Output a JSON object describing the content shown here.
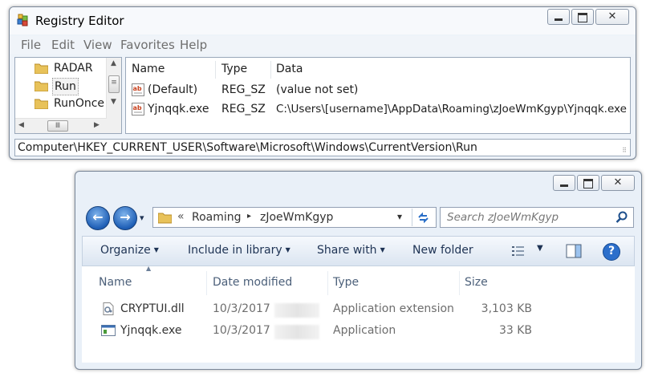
{
  "registry": {
    "title": "Registry Editor",
    "menu": [
      "File",
      "Edit",
      "View",
      "Favorites",
      "Help"
    ],
    "tree": [
      {
        "label": "RADAR",
        "selected": false
      },
      {
        "label": "Run",
        "selected": true
      },
      {
        "label": "RunOnce",
        "selected": false
      }
    ],
    "columns": [
      "Name",
      "Type",
      "Data"
    ],
    "values": [
      {
        "name": "(Default)",
        "type": "REG_SZ",
        "data": "(value not set)"
      },
      {
        "name": "Yjnqqk.exe",
        "type": "REG_SZ",
        "data": "C:\\Users\\[username]\\AppData\\Roaming\\zJoeWmKgyp\\Yjnqqk.exe"
      }
    ],
    "status": "Computer\\HKEY_CURRENT_USER\\Software\\Microsoft\\Windows\\CurrentVersion\\Run"
  },
  "explorer": {
    "breadcrumb_prefix": "«",
    "breadcrumb": [
      "Roaming",
      "zJoeWmKgyp"
    ],
    "search_placeholder": "Search zJoeWmKgyp",
    "toolbar": {
      "organize": "Organize",
      "include": "Include in library",
      "share": "Share with",
      "new_folder": "New folder"
    },
    "columns": [
      "Name",
      "Date modified",
      "Type",
      "Size"
    ],
    "files": [
      {
        "name": "CRYPTUI.dll",
        "date": "10/3/2017",
        "type": "Application extension",
        "size": "3,103 KB"
      },
      {
        "name": "Yjnqqk.exe",
        "date": "10/3/2017",
        "type": "Application",
        "size": "33 KB"
      }
    ]
  },
  "icons": {
    "caption_close": "✕",
    "back": "←",
    "forward": "→",
    "chevron": "▸",
    "dropdown": "▾",
    "search": "⚲",
    "help": "?"
  },
  "colors": {
    "accent": "#1f5fb6",
    "help": "#2c6fcb"
  }
}
